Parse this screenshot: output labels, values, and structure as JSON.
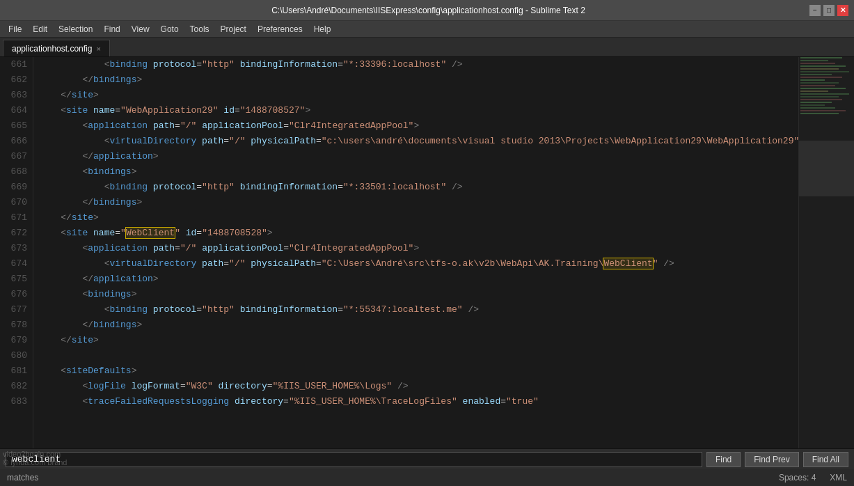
{
  "titleBar": {
    "title": "C:\\Users\\André\\Documents\\IISExpress\\config\\applicationhost.config - Sublime Text 2",
    "minBtn": "−",
    "maxBtn": "□",
    "closeBtn": "✕"
  },
  "menuBar": {
    "items": [
      "File",
      "Edit",
      "Selection",
      "Find",
      "View",
      "Goto",
      "Tools",
      "Project",
      "Preferences",
      "Help"
    ]
  },
  "tab": {
    "name": "applicationhost.config",
    "close": "×",
    "active": true
  },
  "lines": [
    {
      "num": "661",
      "content": "            <binding protocol=\"http\" bindingInformation=\"*:33396:localhost\" />"
    },
    {
      "num": "662",
      "content": "        </bindings>"
    },
    {
      "num": "663",
      "content": "    </site>"
    },
    {
      "num": "664",
      "content": "    <site name=\"WebApplication29\" id=\"1488708527\">"
    },
    {
      "num": "665",
      "content": "        <application path=\"/\" applicationPool=\"Clr4IntegratedAppPool\">"
    },
    {
      "num": "666",
      "content": "            <virtualDirectory path=\"/\" physicalPath=\"c:\\users\\andré\\documents\\visual studio 2013\\Projects\\WebApplication29\\WebApplication29\" />"
    },
    {
      "num": "667",
      "content": "        </application>"
    },
    {
      "num": "668",
      "content": "        <bindings>"
    },
    {
      "num": "669",
      "content": "            <binding protocol=\"http\" bindingInformation=\"*:33501:localhost\" />"
    },
    {
      "num": "670",
      "content": "        </bindings>"
    },
    {
      "num": "671",
      "content": "    </site>"
    },
    {
      "num": "672",
      "content": "    <site name=\"WebClient\" id=\"1488708528\">"
    },
    {
      "num": "673",
      "content": "        <application path=\"/\" applicationPool=\"Clr4IntegratedAppPool\">"
    },
    {
      "num": "674",
      "content": "            <virtualDirectory path=\"/\" physicalPath=\"C:\\Users\\André\\src\\tfs-o.ak\\v2b\\WebApi\\AK.Training\\WebClient\" />"
    },
    {
      "num": "675",
      "content": "        </application>"
    },
    {
      "num": "676",
      "content": "        <bindings>"
    },
    {
      "num": "677",
      "content": "            <binding protocol=\"http\" bindingInformation=\"*:55347:localtest.me\" />"
    },
    {
      "num": "678",
      "content": "        </bindings>"
    },
    {
      "num": "679",
      "content": "    </site>"
    },
    {
      "num": "680",
      "content": ""
    },
    {
      "num": "681",
      "content": "    <siteDefaults>"
    },
    {
      "num": "682",
      "content": "        <logFile logFormat=\"W3C\" directory=\"%IIS_USER_HOME%\\Logs\" />"
    },
    {
      "num": "683",
      "content": "        <traceFailedRequestsLogging directory=\"%IIS_USER_HOME%\\TraceLogFiles\" enabled=\"true\""
    }
  ],
  "findBar": {
    "inputValue": "webclient",
    "findBtn": "Find",
    "findPrevBtn": "Find Prev",
    "findAllBtn": "Find All"
  },
  "statusBar": {
    "left": "matches",
    "spacesLabel": "Spaces: 4",
    "langLabel": "XML"
  },
  "watermark": {
    "line1": "video2bgain.com",
    "line2": "© lynda.com brand"
  }
}
